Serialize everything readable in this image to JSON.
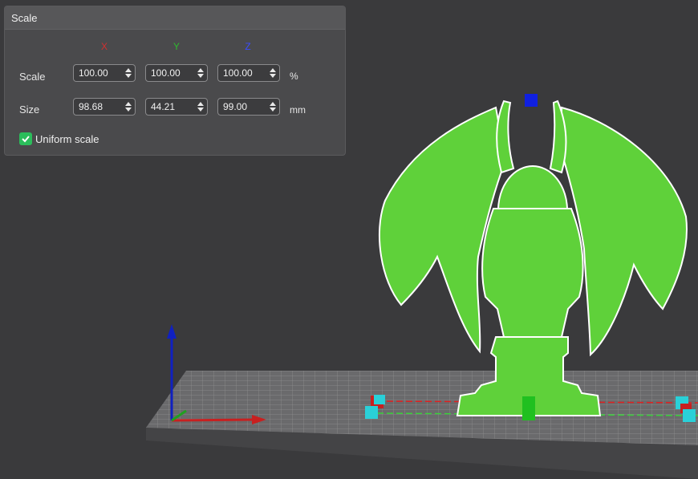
{
  "panel": {
    "title": "Scale",
    "axes": [
      {
        "label": "X",
        "color": "#d03030"
      },
      {
        "label": "Y",
        "color": "#2eb82e"
      },
      {
        "label": "Z",
        "color": "#3a4cff"
      }
    ],
    "scale": {
      "label": "Scale",
      "x": "100.00",
      "y": "100.00",
      "z": "100.00",
      "unit": "%"
    },
    "size": {
      "label": "Size",
      "x": "98.68",
      "y": "44.21",
      "z": "99.00",
      "unit": "mm"
    },
    "uniform_scale": {
      "label": "Uniform scale",
      "checked": true
    }
  },
  "viewport": {
    "model_color": "#5fd13a",
    "background": "#3a3a3c",
    "icons": [
      "axis-gizmo",
      "scale-handle"
    ]
  }
}
